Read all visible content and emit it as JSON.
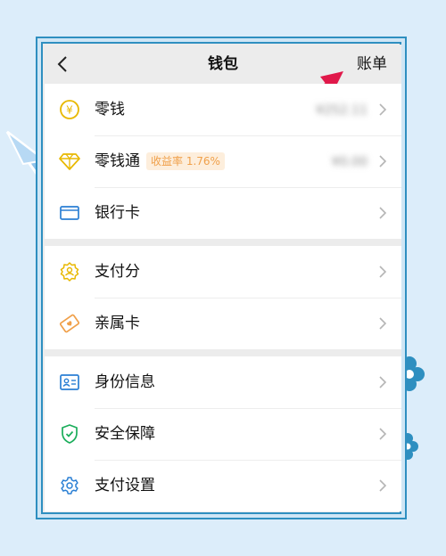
{
  "header": {
    "title": "钱包",
    "bill_label": "账单"
  },
  "groups": [
    {
      "items": [
        {
          "label": "零钱",
          "value": "¥252.11"
        },
        {
          "label": "零钱通",
          "badge": "收益率 1.76%",
          "value": "¥0.00"
        },
        {
          "label": "银行卡"
        }
      ]
    },
    {
      "items": [
        {
          "label": "支付分"
        },
        {
          "label": "亲属卡"
        }
      ]
    },
    {
      "items": [
        {
          "label": "身份信息"
        },
        {
          "label": "安全保障"
        },
        {
          "label": "支付设置"
        }
      ]
    }
  ],
  "colors": {
    "frame": "#2e8fc0",
    "arrow": "#e0184a",
    "coin": "#e8b800",
    "bank": "#2a7fd4",
    "security": "#1aad5a",
    "badge_bg": "#fdeedc",
    "badge_text": "#f0a04a"
  }
}
